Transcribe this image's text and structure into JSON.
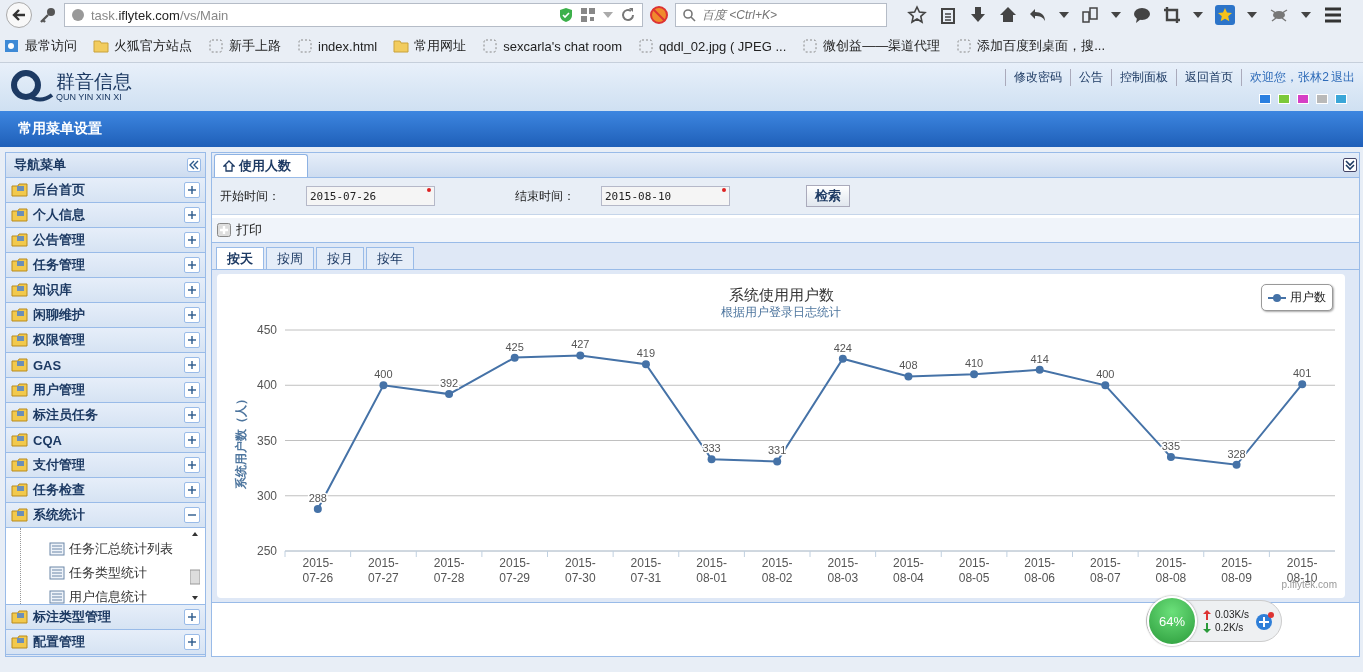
{
  "browser": {
    "url": "task.**iflytek.com**/vs/Main",
    "search": {
      "placeholder": "百度 <Ctrl+K>"
    },
    "bookmarks": [
      {
        "label": "最常访问",
        "kind": "special"
      },
      {
        "label": "火狐官方站点",
        "kind": "folder"
      },
      {
        "label": "新手上路",
        "kind": "page"
      },
      {
        "label": "index.html",
        "kind": "page"
      },
      {
        "label": "常用网址",
        "kind": "folder"
      },
      {
        "label": "sexcarla's chat room",
        "kind": "page"
      },
      {
        "label": "qddl_02.jpg ( JPEG ...",
        "kind": "page"
      },
      {
        "label": "微创益——渠道代理",
        "kind": "page"
      },
      {
        "label": "添加百度到桌面，搜...",
        "kind": "page"
      }
    ]
  },
  "header": {
    "logo_name": "群音信息",
    "logo_sub": "QUN YIN XIN XI",
    "links": [
      "修改密码",
      "公告",
      "控制面板",
      "返回首页"
    ],
    "welcome": "欢迎您，张林2",
    "logout": "退出",
    "themes": [
      {
        "color": "#2a7fe0"
      },
      {
        "color": "#7cc93a"
      },
      {
        "color": "#d63fc5"
      },
      {
        "color": "#b9b9b9"
      },
      {
        "color": "#3aa6d8"
      }
    ]
  },
  "menu_bar": {
    "title": "常用菜单设置"
  },
  "sidebar": {
    "title": "导航菜单",
    "items": [
      {
        "label": "后台首页",
        "expanded": false
      },
      {
        "label": "个人信息",
        "expanded": false
      },
      {
        "label": "公告管理",
        "expanded": false
      },
      {
        "label": "任务管理",
        "expanded": false
      },
      {
        "label": "知识库",
        "expanded": false
      },
      {
        "label": "闲聊维护",
        "expanded": false
      },
      {
        "label": "权限管理",
        "expanded": false
      },
      {
        "label": "GAS",
        "expanded": false
      },
      {
        "label": "用户管理",
        "expanded": false
      },
      {
        "label": "标注员任务",
        "expanded": false
      },
      {
        "label": "CQA",
        "expanded": false
      },
      {
        "label": "支付管理",
        "expanded": false
      },
      {
        "label": "任务检查",
        "expanded": false
      },
      {
        "label": "系统统计",
        "expanded": true,
        "children": [
          {
            "label": "任务汇总统计列表"
          },
          {
            "label": "任务类型统计"
          },
          {
            "label": "用户信息统计"
          }
        ]
      },
      {
        "label": "标注类型管理",
        "expanded": false
      },
      {
        "label": "配置管理",
        "expanded": false
      }
    ]
  },
  "page_tab": {
    "label": "使用人数",
    "selected": true
  },
  "filter": {
    "start_label": "开始时间：",
    "start_value": "2015-07-26",
    "start_required": true,
    "end_label": "结束时间：",
    "end_value": "2015-08-10",
    "end_required": true,
    "search_button": "检索"
  },
  "toolbar": {
    "print": "打印"
  },
  "period_tabs": [
    {
      "label": "按天",
      "selected": true
    },
    {
      "label": "按周",
      "selected": false
    },
    {
      "label": "按月",
      "selected": false
    },
    {
      "label": "按年",
      "selected": false
    }
  ],
  "chart": {
    "credit": "p.iflytek.com",
    "chart_data": {
      "type": "line",
      "title": "系统使用用户数",
      "subtitle": "根据用户登录日志统计",
      "ylabel": "系统用户数（人）",
      "categories": [
        "2015-07-26",
        "2015-07-27",
        "2015-07-28",
        "2015-07-29",
        "2015-07-30",
        "2015-07-31",
        "2015-08-01",
        "2015-08-02",
        "2015-08-03",
        "2015-08-04",
        "2015-08-05",
        "2015-08-06",
        "2015-08-07",
        "2015-08-08",
        "2015-08-09",
        "2015-08-10"
      ],
      "series": [
        {
          "name": "用户数",
          "color": "#4572a7",
          "values": [
            288,
            400,
            392,
            425,
            427,
            419,
            333,
            331,
            424,
            408,
            410,
            414,
            400,
            335,
            328,
            401
          ]
        }
      ],
      "ylim": [
        250,
        450
      ],
      "yticks": [
        250,
        300,
        350,
        400,
        450
      ],
      "grid": true,
      "marker": true,
      "data_labels": true
    }
  },
  "net_widget": {
    "percent": "64%",
    "upload": "0.03K/s",
    "download": "0.2K/s"
  }
}
